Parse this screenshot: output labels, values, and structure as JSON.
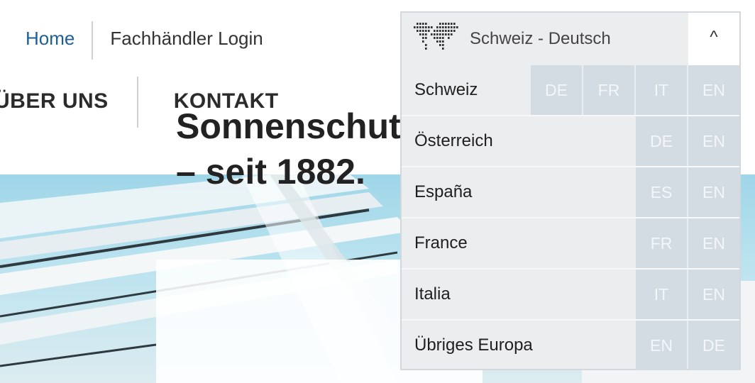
{
  "top_links": {
    "home": "Home",
    "dealer_login": "Fachhändler Login"
  },
  "main_nav": {
    "about": "ÜBER UNS",
    "contact": "KONTAKT"
  },
  "hero": {
    "line1": "Sonnenschutz",
    "line2": "– seit 1882."
  },
  "region_selector": {
    "current": "Schweiz - Deutsch",
    "logo_icon": "world-map-icon",
    "toggle_icon": "chevron-up-icon",
    "toggle_glyph": "^",
    "countries": [
      {
        "name": "Schweiz",
        "langs": [
          "DE",
          "FR",
          "IT",
          "EN"
        ]
      },
      {
        "name": "Österreich",
        "langs": [
          "DE",
          "EN"
        ]
      },
      {
        "name": "España",
        "langs": [
          "ES",
          "EN"
        ]
      },
      {
        "name": "France",
        "langs": [
          "FR",
          "EN"
        ]
      },
      {
        "name": "Italia",
        "langs": [
          "IT",
          "EN"
        ]
      },
      {
        "name": "Übriges Europa",
        "langs": [
          "EN",
          "DE"
        ]
      }
    ]
  },
  "colors": {
    "link_blue": "#1e5f96",
    "lang_tile": "#d3dbe3",
    "panel_bg": "#ecedef"
  }
}
